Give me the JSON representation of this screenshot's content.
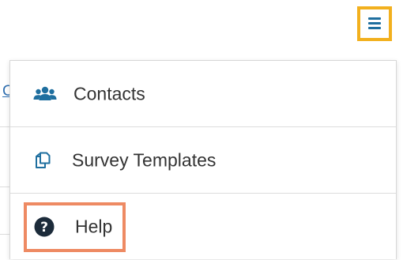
{
  "header": {
    "menu_toggle_icon": "hamburger-icon",
    "menu_toggle_color": "#1f6f9f",
    "highlight_color": "#f2b01e"
  },
  "background": {
    "link_glimpse": "C"
  },
  "menu": {
    "items": [
      {
        "label": "Contacts",
        "icon": "users-icon"
      },
      {
        "label": "Survey Templates",
        "icon": "copy-icon"
      },
      {
        "label": "Help",
        "icon": "question-circle-icon",
        "highlighted": true,
        "highlight_color": "#ee8a63"
      }
    ]
  }
}
